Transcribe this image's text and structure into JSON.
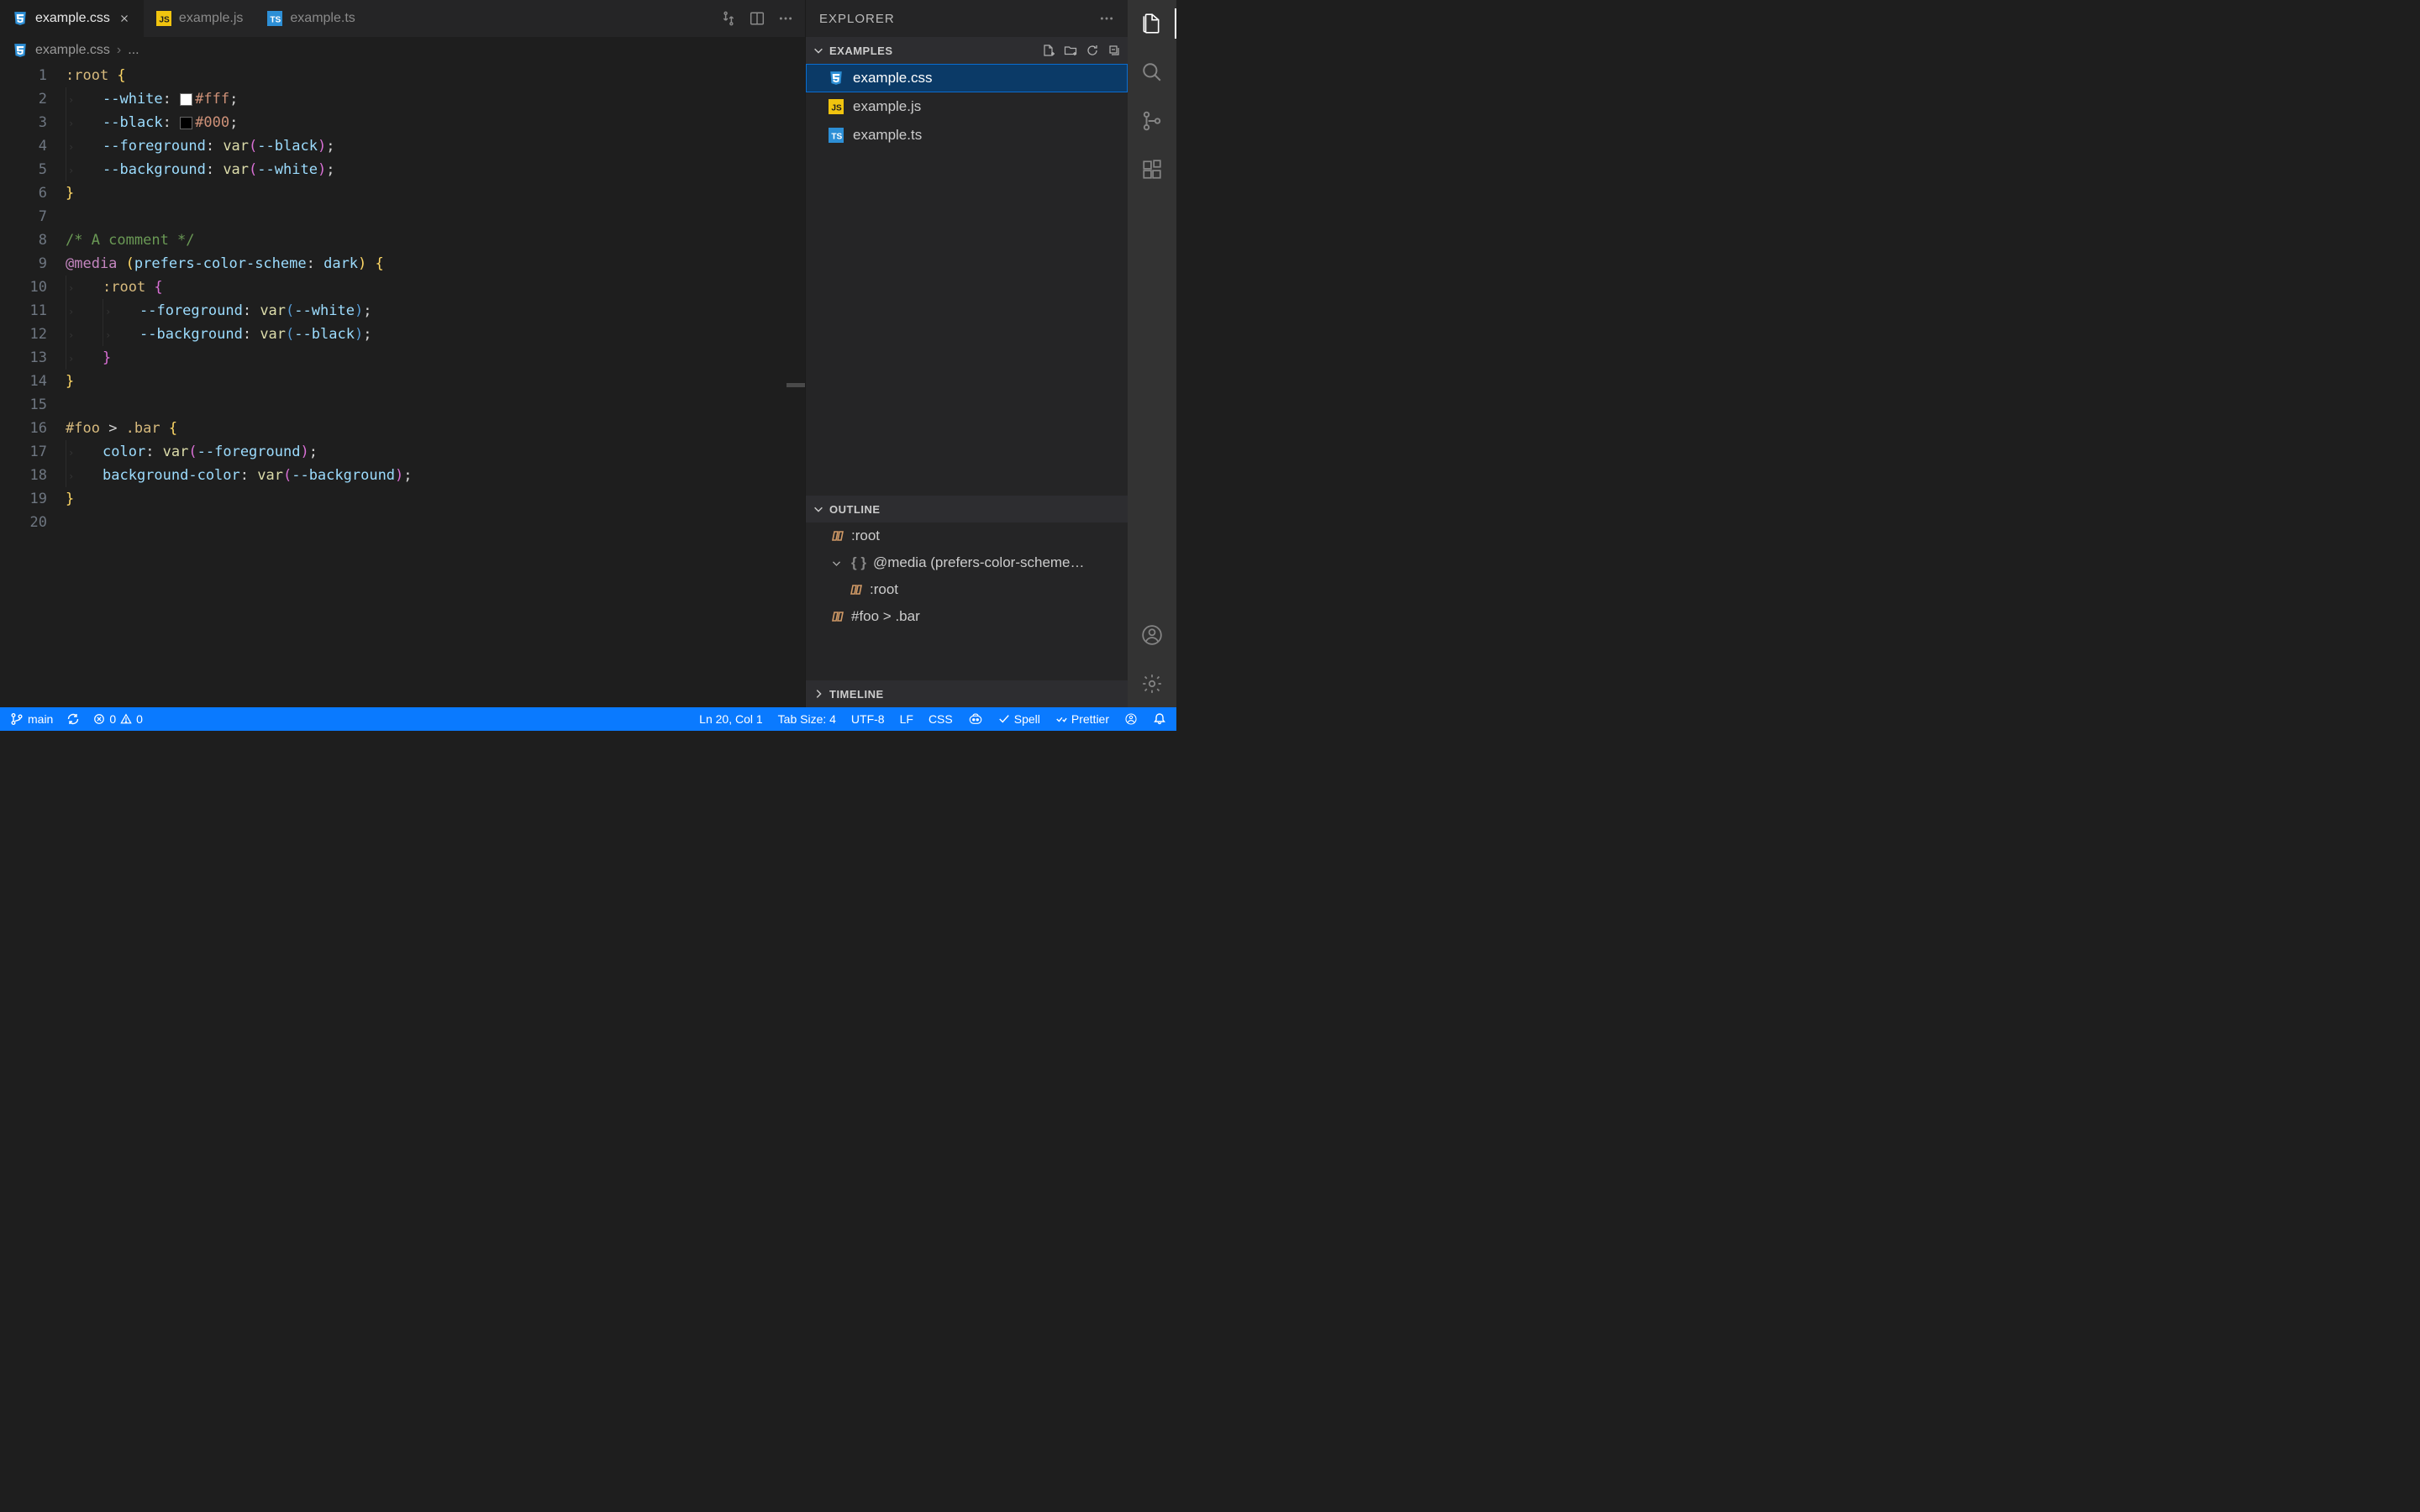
{
  "tabs": [
    {
      "label": "example.css",
      "type": "css",
      "active": true
    },
    {
      "label": "example.js",
      "type": "js",
      "active": false
    },
    {
      "label": "example.ts",
      "type": "ts",
      "active": false
    }
  ],
  "breadcrumb": {
    "file": "example.css",
    "more": "..."
  },
  "code": {
    "lines": [
      {
        "n": 1,
        "segs": [
          [
            ":root ",
            "sel"
          ],
          [
            "{",
            "punc"
          ]
        ]
      },
      {
        "n": 2,
        "indent": 1,
        "segs": [
          [
            "--white",
            "prop"
          ],
          [
            ": ",
            "plain"
          ],
          [
            "#fff",
            "val",
            "swatch-white"
          ],
          [
            ";",
            "plain"
          ]
        ]
      },
      {
        "n": 3,
        "indent": 1,
        "segs": [
          [
            "--black",
            "prop"
          ],
          [
            ": ",
            "plain"
          ],
          [
            "#000",
            "val",
            "swatch-black"
          ],
          [
            ";",
            "plain"
          ]
        ]
      },
      {
        "n": 4,
        "indent": 1,
        "segs": [
          [
            "--foreground",
            "prop"
          ],
          [
            ": ",
            "plain"
          ],
          [
            "var",
            "func"
          ],
          [
            "(",
            "parenp"
          ],
          [
            "--black",
            "inner"
          ],
          [
            ")",
            "parenp"
          ],
          [
            ";",
            "plain"
          ]
        ]
      },
      {
        "n": 5,
        "indent": 1,
        "segs": [
          [
            "--background",
            "prop"
          ],
          [
            ": ",
            "plain"
          ],
          [
            "var",
            "func"
          ],
          [
            "(",
            "parenp"
          ],
          [
            "--white",
            "inner"
          ],
          [
            ")",
            "parenp"
          ],
          [
            ";",
            "plain"
          ]
        ]
      },
      {
        "n": 6,
        "segs": [
          [
            "}",
            "punc"
          ]
        ]
      },
      {
        "n": 7,
        "segs": []
      },
      {
        "n": 8,
        "segs": [
          [
            "/* A comment */",
            "com"
          ]
        ]
      },
      {
        "n": 9,
        "segs": [
          [
            "@media ",
            "kw"
          ],
          [
            "(",
            "punc"
          ],
          [
            "prefers-color-scheme",
            "prop"
          ],
          [
            ": ",
            "plain"
          ],
          [
            "dark",
            "val2"
          ],
          [
            ") ",
            "punc"
          ],
          [
            "{",
            "punc"
          ]
        ]
      },
      {
        "n": 10,
        "indent": 1,
        "segs": [
          [
            ":root ",
            "sel"
          ],
          [
            "{",
            "parenp"
          ]
        ]
      },
      {
        "n": 11,
        "indent": 2,
        "segs": [
          [
            "--foreground",
            "prop"
          ],
          [
            ": ",
            "plain"
          ],
          [
            "var",
            "func"
          ],
          [
            "(",
            "paren"
          ],
          [
            "--white",
            "inner"
          ],
          [
            ")",
            "paren"
          ],
          [
            ";",
            "plain"
          ]
        ]
      },
      {
        "n": 12,
        "indent": 2,
        "segs": [
          [
            "--background",
            "prop"
          ],
          [
            ": ",
            "plain"
          ],
          [
            "var",
            "func"
          ],
          [
            "(",
            "paren"
          ],
          [
            "--black",
            "inner"
          ],
          [
            ")",
            "paren"
          ],
          [
            ";",
            "plain"
          ]
        ]
      },
      {
        "n": 13,
        "indent": 1,
        "segs": [
          [
            "}",
            "parenp"
          ]
        ]
      },
      {
        "n": 14,
        "segs": [
          [
            "}",
            "punc"
          ]
        ]
      },
      {
        "n": 15,
        "segs": []
      },
      {
        "n": 16,
        "segs": [
          [
            "#foo ",
            "sel"
          ],
          [
            "> ",
            "plain"
          ],
          [
            ".bar ",
            "sel"
          ],
          [
            "{",
            "punc"
          ]
        ]
      },
      {
        "n": 17,
        "indent": 1,
        "segs": [
          [
            "color",
            "prop"
          ],
          [
            ": ",
            "plain"
          ],
          [
            "var",
            "func"
          ],
          [
            "(",
            "parenp"
          ],
          [
            "--foreground",
            "inner"
          ],
          [
            ")",
            "parenp"
          ],
          [
            ";",
            "plain"
          ]
        ]
      },
      {
        "n": 18,
        "indent": 1,
        "segs": [
          [
            "background-color",
            "prop"
          ],
          [
            ": ",
            "plain"
          ],
          [
            "var",
            "func"
          ],
          [
            "(",
            "parenp"
          ],
          [
            "--background",
            "inner"
          ],
          [
            ")",
            "parenp"
          ],
          [
            ";",
            "plain"
          ]
        ]
      },
      {
        "n": 19,
        "segs": [
          [
            "}",
            "punc"
          ]
        ]
      },
      {
        "n": 20,
        "segs": []
      }
    ]
  },
  "explorer": {
    "title": "EXPLORER",
    "section": "EXAMPLES",
    "files": [
      {
        "label": "example.css",
        "type": "css",
        "active": true
      },
      {
        "label": "example.js",
        "type": "js",
        "active": false
      },
      {
        "label": "example.ts",
        "type": "ts",
        "active": false
      }
    ]
  },
  "outline": {
    "title": "OUTLINE",
    "items": [
      {
        "label": ":root",
        "kind": "rule",
        "depth": 0
      },
      {
        "label": "@media (prefers-color-scheme…",
        "kind": "group",
        "depth": 0,
        "expanded": true
      },
      {
        "label": ":root",
        "kind": "rule",
        "depth": 1
      },
      {
        "label": "#foo > .bar",
        "kind": "rule",
        "depth": 0
      }
    ]
  },
  "timeline": {
    "title": "TIMELINE"
  },
  "status": {
    "branch": "main",
    "errors": "0",
    "warnings": "0",
    "position": "Ln 20, Col 1",
    "tabsize": "Tab Size: 4",
    "encoding": "UTF-8",
    "eol": "LF",
    "language": "CSS",
    "spell": "Spell",
    "prettier": "Prettier"
  }
}
